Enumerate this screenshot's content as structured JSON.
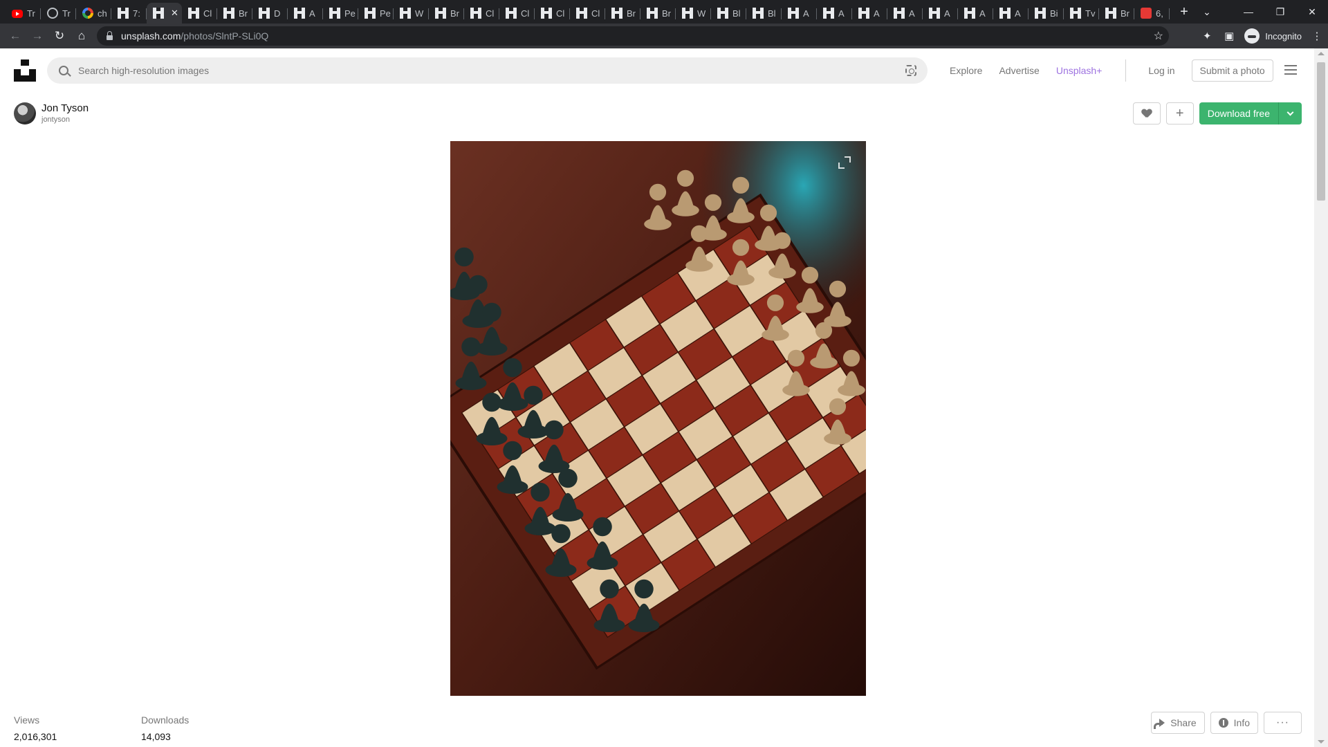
{
  "browser": {
    "tabs": [
      {
        "favicon": "youtube-icon",
        "label": "Tr"
      },
      {
        "favicon": "globe-icon",
        "label": "Tr"
      },
      {
        "favicon": "google-icon",
        "label": "ch"
      },
      {
        "favicon": "unsplash-icon",
        "label": "7:"
      },
      {
        "favicon": "unsplash-icon",
        "label": "",
        "active": true
      },
      {
        "favicon": "unsplash-icon",
        "label": "Cl"
      },
      {
        "favicon": "unsplash-icon",
        "label": "Br"
      },
      {
        "favicon": "unsplash-icon",
        "label": "D"
      },
      {
        "favicon": "unsplash-icon",
        "label": "A"
      },
      {
        "favicon": "unsplash-icon",
        "label": "Pe"
      },
      {
        "favicon": "unsplash-icon",
        "label": "Pe"
      },
      {
        "favicon": "unsplash-icon",
        "label": "W"
      },
      {
        "favicon": "unsplash-icon",
        "label": "Br"
      },
      {
        "favicon": "unsplash-icon",
        "label": "Cl"
      },
      {
        "favicon": "unsplash-icon",
        "label": "Cl"
      },
      {
        "favicon": "unsplash-icon",
        "label": "Cl"
      },
      {
        "favicon": "unsplash-icon",
        "label": "Cl"
      },
      {
        "favicon": "unsplash-icon",
        "label": "Br"
      },
      {
        "favicon": "unsplash-icon",
        "label": "Br"
      },
      {
        "favicon": "unsplash-icon",
        "label": "W"
      },
      {
        "favicon": "unsplash-icon",
        "label": "Bl"
      },
      {
        "favicon": "unsplash-icon",
        "label": "Bl"
      },
      {
        "favicon": "unsplash-icon",
        "label": "A"
      },
      {
        "favicon": "unsplash-icon",
        "label": "A"
      },
      {
        "favicon": "unsplash-icon",
        "label": "A"
      },
      {
        "favicon": "unsplash-icon",
        "label": "A"
      },
      {
        "favicon": "unsplash-icon",
        "label": "A"
      },
      {
        "favicon": "unsplash-icon",
        "label": "A"
      },
      {
        "favicon": "unsplash-icon",
        "label": "A"
      },
      {
        "favicon": "unsplash-icon",
        "label": "Bi"
      },
      {
        "favicon": "unsplash-icon",
        "label": "Tv"
      },
      {
        "favicon": "unsplash-icon",
        "label": "Br"
      },
      {
        "favicon": "red-app-icon",
        "label": "6,"
      }
    ],
    "new_tab": "+",
    "url_host": "unsplash.com",
    "url_path": "/photos/SlntP-SLi0Q",
    "profile_label": "Incognito"
  },
  "site": {
    "search_placeholder": "Search high-resolution images",
    "nav": {
      "explore": "Explore",
      "advertise": "Advertise",
      "unsplash_plus": "Unsplash+",
      "login": "Log in",
      "submit": "Submit a photo"
    }
  },
  "photo_page": {
    "author_name": "Jon Tyson",
    "author_handle": "jontyson",
    "download_label": "Download free",
    "stats": [
      {
        "label": "Views",
        "value": "2,016,301"
      },
      {
        "label": "Downloads",
        "value": "14,093"
      }
    ],
    "share_label": "Share",
    "info_label": "Info",
    "more_label": "···"
  },
  "colors": {
    "accent_green": "#3cb46e",
    "unsplash_plus": "#9d72e0",
    "chrome_dark": "#202124"
  }
}
